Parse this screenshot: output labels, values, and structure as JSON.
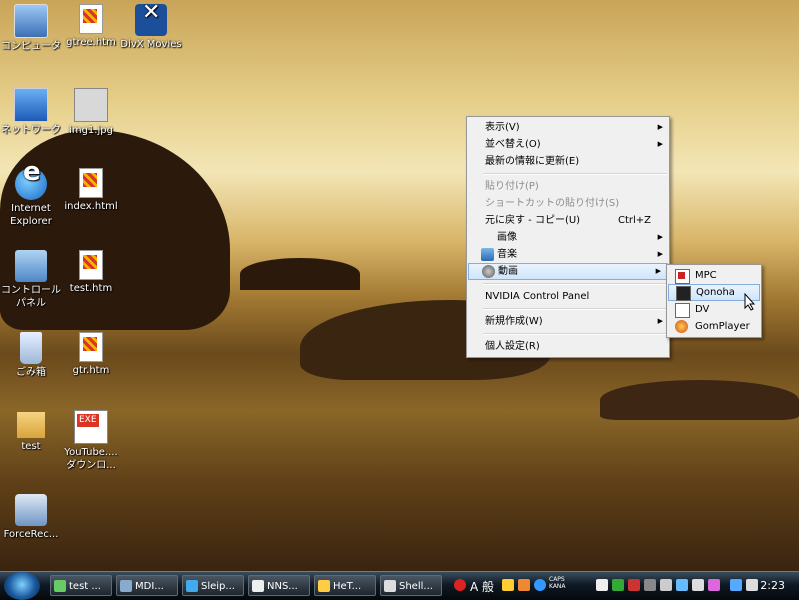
{
  "desktop": {
    "icons": [
      {
        "label": "コンピュータ",
        "icon": "computer-icon"
      },
      {
        "label": "gtree.htm",
        "icon": "html-file-icon"
      },
      {
        "label": "DivX Movies",
        "icon": "divx-shortcut-icon"
      },
      {
        "label": "ネットワーク",
        "icon": "network-icon"
      },
      {
        "label": "img1.jpg",
        "icon": "image-file-icon"
      },
      {
        "label": "Internet Explorer",
        "icon": "internet-explorer-icon"
      },
      {
        "label": "index.html",
        "icon": "html-file-icon"
      },
      {
        "label": "コントロール パネル",
        "icon": "control-panel-icon"
      },
      {
        "label": "test.htm",
        "icon": "html-file-icon"
      },
      {
        "label": "ごみ箱",
        "icon": "recycle-bin-icon"
      },
      {
        "label": "gtr.htm",
        "icon": "html-file-icon"
      },
      {
        "label": "test",
        "icon": "folder-icon"
      },
      {
        "label": "YouTube.... ダウンロ...",
        "icon": "exe-file-icon"
      },
      {
        "label": "ForceRec...",
        "icon": "exe-file-icon"
      }
    ]
  },
  "context_menu": {
    "items": [
      {
        "label": "表示(V)",
        "has_submenu": true
      },
      {
        "label": "並べ替え(O)",
        "has_submenu": true
      },
      {
        "label": "最新の情報に更新(E)"
      },
      {
        "label": "貼り付け(P)",
        "disabled": true
      },
      {
        "label": "ショートカットの貼り付け(S)",
        "disabled": true
      },
      {
        "label": "元に戻す - コピー(U)",
        "shortcut": "Ctrl+Z"
      },
      {
        "label": "画像",
        "has_submenu": true
      },
      {
        "label": "音楽",
        "has_submenu": true
      },
      {
        "label": "動画",
        "has_submenu": true,
        "highlighted": true
      },
      {
        "label": "NVIDIA Control Panel"
      },
      {
        "label": "新規作成(W)",
        "has_submenu": true
      },
      {
        "label": "個人設定(R)"
      }
    ]
  },
  "submenu": {
    "items": [
      {
        "label": "MPC"
      },
      {
        "label": "Qonoha",
        "highlighted": true
      },
      {
        "label": "DV"
      },
      {
        "label": "GomPlayer"
      }
    ]
  },
  "taskbar": {
    "buttons": [
      {
        "label": "test ..."
      },
      {
        "label": "MDI..."
      },
      {
        "label": "Sleip..."
      },
      {
        "label": "NNS..."
      },
      {
        "label": "HeT..."
      },
      {
        "label": "Shell..."
      }
    ],
    "ime": "A 般",
    "caps": "CAPS",
    "kana": "KANA",
    "clock": "2:23"
  },
  "colors": {
    "menu_highlight": "#cfe5fb",
    "taskbar": "#0f1a24"
  }
}
